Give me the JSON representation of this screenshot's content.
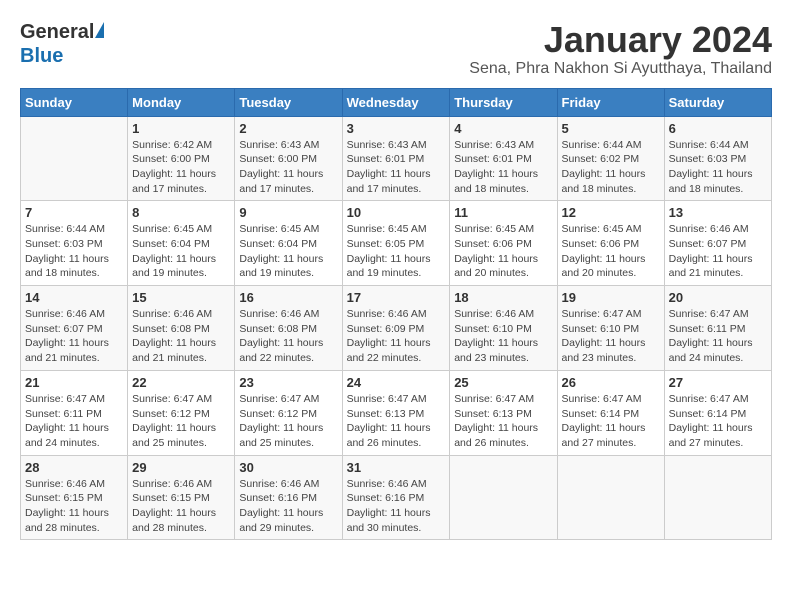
{
  "header": {
    "logo_general": "General",
    "logo_blue": "Blue",
    "month": "January 2024",
    "location": "Sena, Phra Nakhon Si Ayutthaya, Thailand"
  },
  "weekdays": [
    "Sunday",
    "Monday",
    "Tuesday",
    "Wednesday",
    "Thursday",
    "Friday",
    "Saturday"
  ],
  "weeks": [
    [
      {
        "day": "",
        "details": ""
      },
      {
        "day": "1",
        "details": "Sunrise: 6:42 AM\nSunset: 6:00 PM\nDaylight: 11 hours\nand 17 minutes."
      },
      {
        "day": "2",
        "details": "Sunrise: 6:43 AM\nSunset: 6:00 PM\nDaylight: 11 hours\nand 17 minutes."
      },
      {
        "day": "3",
        "details": "Sunrise: 6:43 AM\nSunset: 6:01 PM\nDaylight: 11 hours\nand 17 minutes."
      },
      {
        "day": "4",
        "details": "Sunrise: 6:43 AM\nSunset: 6:01 PM\nDaylight: 11 hours\nand 18 minutes."
      },
      {
        "day": "5",
        "details": "Sunrise: 6:44 AM\nSunset: 6:02 PM\nDaylight: 11 hours\nand 18 minutes."
      },
      {
        "day": "6",
        "details": "Sunrise: 6:44 AM\nSunset: 6:03 PM\nDaylight: 11 hours\nand 18 minutes."
      }
    ],
    [
      {
        "day": "7",
        "details": "Sunrise: 6:44 AM\nSunset: 6:03 PM\nDaylight: 11 hours\nand 18 minutes."
      },
      {
        "day": "8",
        "details": "Sunrise: 6:45 AM\nSunset: 6:04 PM\nDaylight: 11 hours\nand 19 minutes."
      },
      {
        "day": "9",
        "details": "Sunrise: 6:45 AM\nSunset: 6:04 PM\nDaylight: 11 hours\nand 19 minutes."
      },
      {
        "day": "10",
        "details": "Sunrise: 6:45 AM\nSunset: 6:05 PM\nDaylight: 11 hours\nand 19 minutes."
      },
      {
        "day": "11",
        "details": "Sunrise: 6:45 AM\nSunset: 6:06 PM\nDaylight: 11 hours\nand 20 minutes."
      },
      {
        "day": "12",
        "details": "Sunrise: 6:45 AM\nSunset: 6:06 PM\nDaylight: 11 hours\nand 20 minutes."
      },
      {
        "day": "13",
        "details": "Sunrise: 6:46 AM\nSunset: 6:07 PM\nDaylight: 11 hours\nand 21 minutes."
      }
    ],
    [
      {
        "day": "14",
        "details": "Sunrise: 6:46 AM\nSunset: 6:07 PM\nDaylight: 11 hours\nand 21 minutes."
      },
      {
        "day": "15",
        "details": "Sunrise: 6:46 AM\nSunset: 6:08 PM\nDaylight: 11 hours\nand 21 minutes."
      },
      {
        "day": "16",
        "details": "Sunrise: 6:46 AM\nSunset: 6:08 PM\nDaylight: 11 hours\nand 22 minutes."
      },
      {
        "day": "17",
        "details": "Sunrise: 6:46 AM\nSunset: 6:09 PM\nDaylight: 11 hours\nand 22 minutes."
      },
      {
        "day": "18",
        "details": "Sunrise: 6:46 AM\nSunset: 6:10 PM\nDaylight: 11 hours\nand 23 minutes."
      },
      {
        "day": "19",
        "details": "Sunrise: 6:47 AM\nSunset: 6:10 PM\nDaylight: 11 hours\nand 23 minutes."
      },
      {
        "day": "20",
        "details": "Sunrise: 6:47 AM\nSunset: 6:11 PM\nDaylight: 11 hours\nand 24 minutes."
      }
    ],
    [
      {
        "day": "21",
        "details": "Sunrise: 6:47 AM\nSunset: 6:11 PM\nDaylight: 11 hours\nand 24 minutes."
      },
      {
        "day": "22",
        "details": "Sunrise: 6:47 AM\nSunset: 6:12 PM\nDaylight: 11 hours\nand 25 minutes."
      },
      {
        "day": "23",
        "details": "Sunrise: 6:47 AM\nSunset: 6:12 PM\nDaylight: 11 hours\nand 25 minutes."
      },
      {
        "day": "24",
        "details": "Sunrise: 6:47 AM\nSunset: 6:13 PM\nDaylight: 11 hours\nand 26 minutes."
      },
      {
        "day": "25",
        "details": "Sunrise: 6:47 AM\nSunset: 6:13 PM\nDaylight: 11 hours\nand 26 minutes."
      },
      {
        "day": "26",
        "details": "Sunrise: 6:47 AM\nSunset: 6:14 PM\nDaylight: 11 hours\nand 27 minutes."
      },
      {
        "day": "27",
        "details": "Sunrise: 6:47 AM\nSunset: 6:14 PM\nDaylight: 11 hours\nand 27 minutes."
      }
    ],
    [
      {
        "day": "28",
        "details": "Sunrise: 6:46 AM\nSunset: 6:15 PM\nDaylight: 11 hours\nand 28 minutes."
      },
      {
        "day": "29",
        "details": "Sunrise: 6:46 AM\nSunset: 6:15 PM\nDaylight: 11 hours\nand 28 minutes."
      },
      {
        "day": "30",
        "details": "Sunrise: 6:46 AM\nSunset: 6:16 PM\nDaylight: 11 hours\nand 29 minutes."
      },
      {
        "day": "31",
        "details": "Sunrise: 6:46 AM\nSunset: 6:16 PM\nDaylight: 11 hours\nand 30 minutes."
      },
      {
        "day": "",
        "details": ""
      },
      {
        "day": "",
        "details": ""
      },
      {
        "day": "",
        "details": ""
      }
    ]
  ]
}
